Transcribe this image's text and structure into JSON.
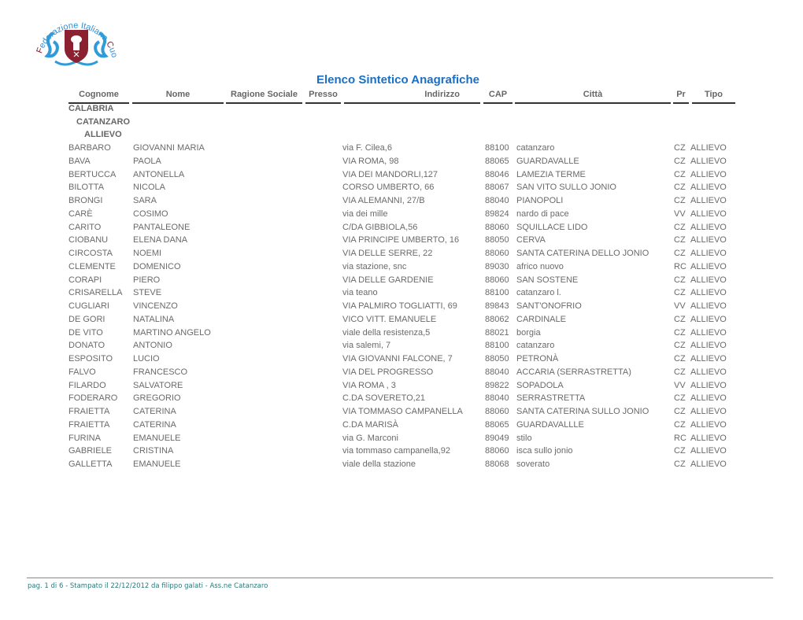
{
  "logo": {
    "text": "Federazione Italiana Cuochi",
    "icon": "chef-shield-emblem-icon",
    "colors": {
      "blue": "#2a8fd6",
      "maroon": "#8a2030",
      "ring": "#2f9bd8"
    }
  },
  "title": "Elenco Sintetico Anagrafiche",
  "columns": [
    "Cognome",
    "Nome",
    "Ragione Sociale",
    "Presso",
    "Indirizzo",
    "CAP",
    "Città",
    "Pr",
    "Tipo"
  ],
  "groups": {
    "region": "CALABRIA",
    "province": "CATANZARO",
    "type": "ALLIEVO"
  },
  "rows": [
    {
      "cognome": "BARBARO",
      "nome": "GIOVANNI MARIA",
      "ragione": "",
      "presso": "",
      "indirizzo": "via F. Cilea,6",
      "cap": "88100",
      "citta": "catanzaro",
      "pr": "CZ",
      "tipo": "ALLIEVO"
    },
    {
      "cognome": "BAVA",
      "nome": "PAOLA",
      "ragione": "",
      "presso": "",
      "indirizzo": "VIA ROMA, 98",
      "cap": "88065",
      "citta": "GUARDAVALLE",
      "pr": "CZ",
      "tipo": "ALLIEVO"
    },
    {
      "cognome": "BERTUCCA",
      "nome": "ANTONELLA",
      "ragione": "",
      "presso": "",
      "indirizzo": "VIA DEI MANDORLI,127",
      "cap": "88046",
      "citta": "LAMEZIA TERME",
      "pr": "CZ",
      "tipo": "ALLIEVO"
    },
    {
      "cognome": "BILOTTA",
      "nome": "NICOLA",
      "ragione": "",
      "presso": "",
      "indirizzo": "CORSO UMBERTO, 66",
      "cap": "88067",
      "citta": "SAN VITO SULLO JONIO",
      "pr": "CZ",
      "tipo": "ALLIEVO"
    },
    {
      "cognome": "BRONGI",
      "nome": "SARA",
      "ragione": "",
      "presso": "",
      "indirizzo": "VIA ALEMANNI, 27/B",
      "cap": "88040",
      "citta": "PIANOPOLI",
      "pr": "CZ",
      "tipo": "ALLIEVO"
    },
    {
      "cognome": "CARÈ",
      "nome": "COSIMO",
      "ragione": "",
      "presso": "",
      "indirizzo": "via dei mille",
      "cap": "89824",
      "citta": "nardo di pace",
      "pr": "VV",
      "tipo": "ALLIEVO"
    },
    {
      "cognome": "CARITO",
      "nome": "PANTALEONE",
      "ragione": "",
      "presso": "",
      "indirizzo": "C/DA GIBBIOLA,56",
      "cap": "88060",
      "citta": "SQUILLACE LIDO",
      "pr": "CZ",
      "tipo": "ALLIEVO"
    },
    {
      "cognome": "CIOBANU",
      "nome": "ELENA DANA",
      "ragione": "",
      "presso": "",
      "indirizzo": "VIA PRINCIPE UMBERTO, 16",
      "cap": "88050",
      "citta": "CERVA",
      "pr": "CZ",
      "tipo": "ALLIEVO"
    },
    {
      "cognome": "CIRCOSTA",
      "nome": "NOEMI",
      "ragione": "",
      "presso": "",
      "indirizzo": "VIA DELLE SERRE, 22",
      "cap": "88060",
      "citta": "SANTA CATERINA DELLO JONIO",
      "pr": "CZ",
      "tipo": "ALLIEVO"
    },
    {
      "cognome": "CLEMENTE",
      "nome": "DOMENICO",
      "ragione": "",
      "presso": "",
      "indirizzo": "via stazione, snc",
      "cap": "89030",
      "citta": "africo nuovo",
      "pr": "RC",
      "tipo": "ALLIEVO"
    },
    {
      "cognome": "CORAPI",
      "nome": "PIERO",
      "ragione": "",
      "presso": "",
      "indirizzo": "VIA DELLE GARDENIE",
      "cap": "88060",
      "citta": "SAN SOSTENE",
      "pr": "CZ",
      "tipo": "ALLIEVO"
    },
    {
      "cognome": "CRISARELLA",
      "nome": "STEVE",
      "ragione": "",
      "presso": "",
      "indirizzo": "via teano",
      "cap": "88100",
      "citta": "catanzaro l.",
      "pr": "CZ",
      "tipo": "ALLIEVO"
    },
    {
      "cognome": "CUGLIARI",
      "nome": "VINCENZO",
      "ragione": "",
      "presso": "",
      "indirizzo": "VIA PALMIRO TOGLIATTI, 69",
      "cap": "89843",
      "citta": "SANT'ONOFRIO",
      "pr": "VV",
      "tipo": "ALLIEVO"
    },
    {
      "cognome": "DE GORI",
      "nome": "NATALINA",
      "ragione": "",
      "presso": "",
      "indirizzo": "VICO VITT. EMANUELE",
      "cap": "88062",
      "citta": "CARDINALE",
      "pr": "CZ",
      "tipo": "ALLIEVO"
    },
    {
      "cognome": "DE VITO",
      "nome": "MARTINO ANGELO",
      "ragione": "",
      "presso": "",
      "indirizzo": "viale della resistenza,5",
      "cap": "88021",
      "citta": "borgia",
      "pr": "CZ",
      "tipo": "ALLIEVO"
    },
    {
      "cognome": "DONATO",
      "nome": "ANTONIO",
      "ragione": "",
      "presso": "",
      "indirizzo": "via salemi, 7",
      "cap": "88100",
      "citta": "catanzaro",
      "pr": "CZ",
      "tipo": "ALLIEVO"
    },
    {
      "cognome": "ESPOSITO",
      "nome": "LUCIO",
      "ragione": "",
      "presso": "",
      "indirizzo": "VIA GIOVANNI FALCONE, 7",
      "cap": "88050",
      "citta": "PETRONÀ",
      "pr": "CZ",
      "tipo": "ALLIEVO"
    },
    {
      "cognome": "FALVO",
      "nome": "FRANCESCO",
      "ragione": "",
      "presso": "",
      "indirizzo": "VIA DEL PROGRESSO",
      "cap": "88040",
      "citta": "ACCARIA (SERRASTRETTA)",
      "pr": "CZ",
      "tipo": "ALLIEVO"
    },
    {
      "cognome": "FILARDO",
      "nome": "SALVATORE",
      "ragione": "",
      "presso": "",
      "indirizzo": "VIA ROMA , 3",
      "cap": "89822",
      "citta": "SOPADOLA",
      "pr": "VV",
      "tipo": "ALLIEVO"
    },
    {
      "cognome": "FODERARO",
      "nome": "GREGORIO",
      "ragione": "",
      "presso": "",
      "indirizzo": "C.DA SOVERETO,21",
      "cap": "88040",
      "citta": "SERRASTRETTA",
      "pr": "CZ",
      "tipo": "ALLIEVO"
    },
    {
      "cognome": "FRAIETTA",
      "nome": "CATERINA",
      "ragione": "",
      "presso": "",
      "indirizzo": "VIA TOMMASO CAMPANELLA",
      "cap": "88060",
      "citta": "SANTA CATERINA SULLO JONIO",
      "pr": "CZ",
      "tipo": "ALLIEVO"
    },
    {
      "cognome": "FRAIETTA",
      "nome": "CATERINA",
      "ragione": "",
      "presso": "",
      "indirizzo": "C.DA MARISÀ",
      "cap": "88065",
      "citta": "GUARDAVALLLE",
      "pr": "CZ",
      "tipo": "ALLIEVO"
    },
    {
      "cognome": "FURINA",
      "nome": "EMANUELE",
      "ragione": "",
      "presso": "",
      "indirizzo": "via G. Marconi",
      "cap": "89049",
      "citta": "stilo",
      "pr": "RC",
      "tipo": "ALLIEVO"
    },
    {
      "cognome": "GABRIELE",
      "nome": "CRISTINA",
      "ragione": "",
      "presso": "",
      "indirizzo": "via tommaso campanella,92",
      "cap": "88060",
      "citta": "isca sullo jonio",
      "pr": "CZ",
      "tipo": "ALLIEVO"
    },
    {
      "cognome": "GALLETTA",
      "nome": "EMANUELE",
      "ragione": "",
      "presso": "",
      "indirizzo": "viale della stazione",
      "cap": "88068",
      "citta": "soverato",
      "pr": "CZ",
      "tipo": "ALLIEVO"
    }
  ],
  "footer": "pag. 1 di 6 - Stampato il 22/12/2012 da filippo galati - Ass.ne Catanzaro"
}
